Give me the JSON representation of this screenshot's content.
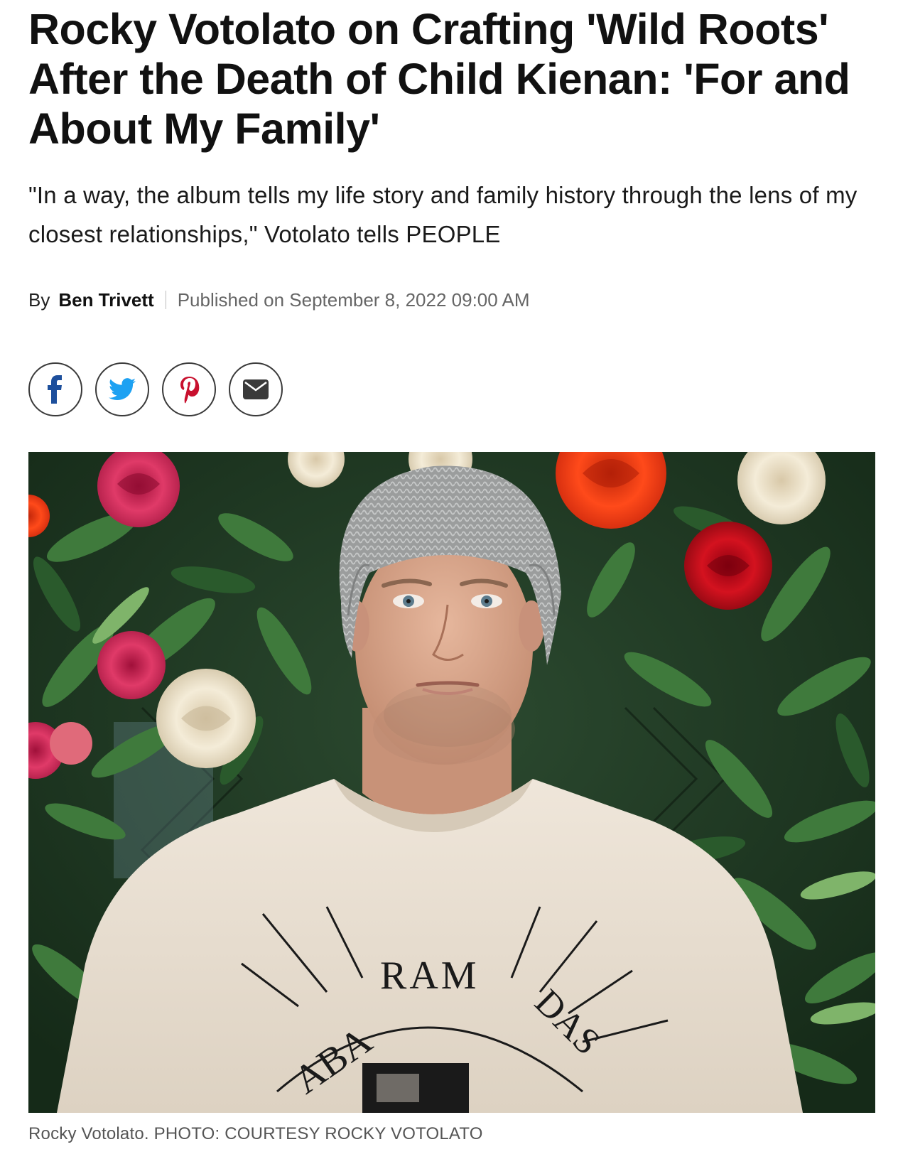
{
  "article": {
    "headline": "Rocky Votolato on Crafting 'Wild Roots' After the Death of Child Kienan: 'For and About My Family'",
    "dek": "\"In a way, the album tells my life story and family history through the lens of my closest relationships,\" Votolato tells PEOPLE",
    "byline": {
      "prefix": "By",
      "author": "Ben Trivett",
      "published": "Published on September 8, 2022 09:00 AM"
    }
  },
  "share": {
    "buttons": [
      {
        "icon": "facebook-icon",
        "color": "#1d4f9c"
      },
      {
        "icon": "twitter-icon",
        "color": "#1da1f2"
      },
      {
        "icon": "pinterest-icon",
        "color": "#c8102e"
      },
      {
        "icon": "email-icon",
        "color": "#3a3a3a"
      }
    ]
  },
  "photo": {
    "caption": "Rocky Votolato. PHOTO: COURTESY ROCKY VOTOLATO",
    "shirt_text_top": "RAM",
    "shirt_text_left": "ABA",
    "shirt_text_right": "DAS"
  }
}
